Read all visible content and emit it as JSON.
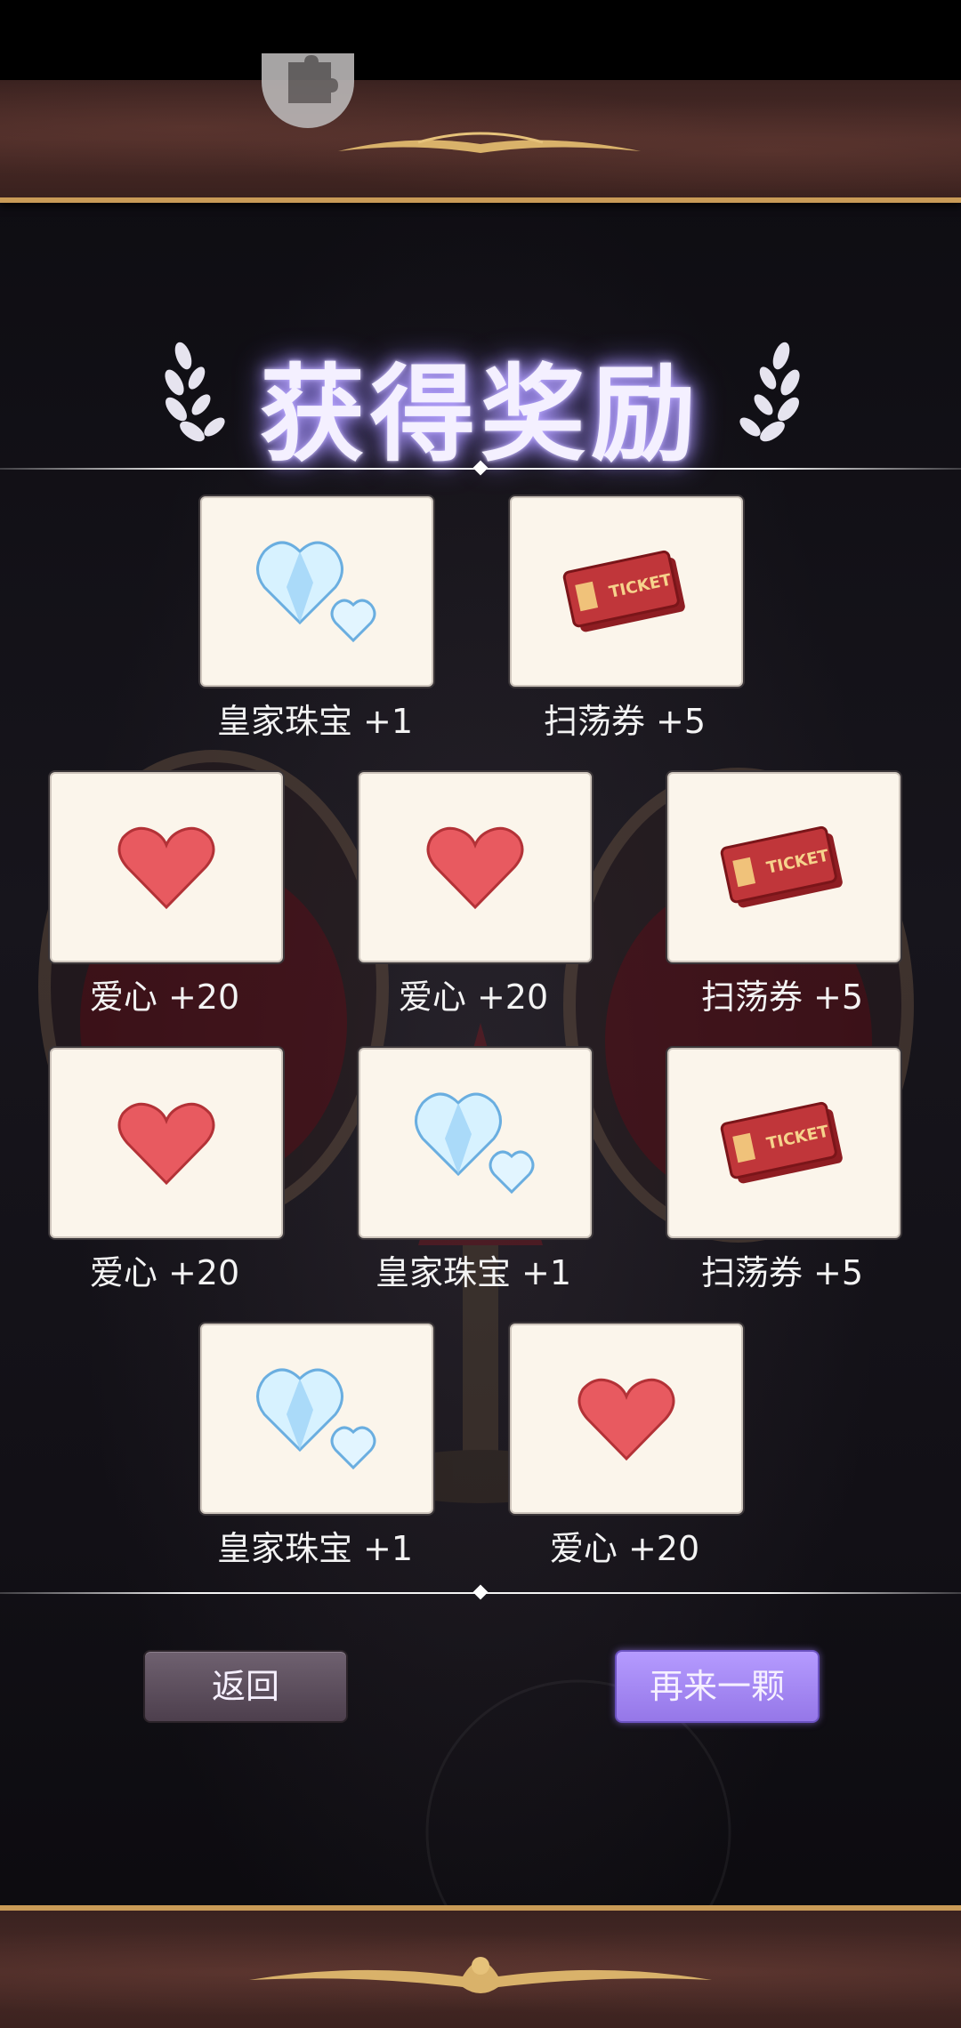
{
  "title": "获得奖励",
  "rewards": [
    {
      "label": "皇家珠宝 +1",
      "icon": "diamond-hearts-icon"
    },
    {
      "label": "扫荡券 +5",
      "icon": "ticket-icon"
    },
    {
      "label": "爱心 +20",
      "icon": "heart-icon"
    },
    {
      "label": "爱心 +20",
      "icon": "heart-icon"
    },
    {
      "label": "扫荡券 +5",
      "icon": "ticket-icon"
    },
    {
      "label": "爱心 +20",
      "icon": "heart-icon"
    },
    {
      "label": "皇家珠宝 +1",
      "icon": "diamond-hearts-icon"
    },
    {
      "label": "扫荡券 +5",
      "icon": "ticket-icon"
    },
    {
      "label": "皇家珠宝 +1",
      "icon": "diamond-hearts-icon"
    },
    {
      "label": "爱心 +20",
      "icon": "heart-icon"
    }
  ],
  "ticket_text": "TICKET",
  "buttons": {
    "back": "返回",
    "again": "再来一颗"
  },
  "colors": {
    "accent": "#a98bff",
    "gold": "#c99b57",
    "card": "#fbf5eb"
  }
}
